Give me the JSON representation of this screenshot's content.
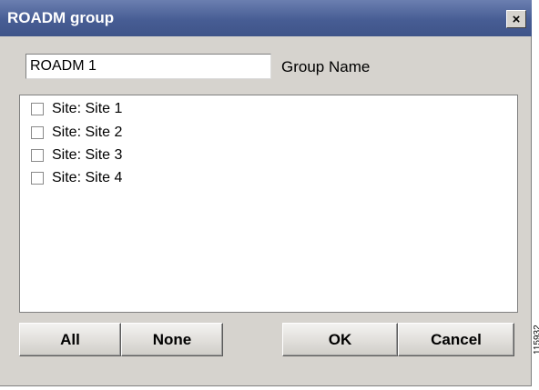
{
  "window": {
    "title": "ROADM group",
    "close_symbol": "×"
  },
  "group_name": {
    "value": "ROADM 1",
    "label": "Group Name"
  },
  "sites": [
    {
      "label": "Site: Site 1",
      "checked": false
    },
    {
      "label": "Site: Site 2",
      "checked": false
    },
    {
      "label": "Site: Site 3",
      "checked": false
    },
    {
      "label": "Site: Site 4",
      "checked": false
    }
  ],
  "buttons": {
    "all": "All",
    "none": "None",
    "ok": "OK",
    "cancel": "Cancel"
  },
  "side_code": "115932",
  "colors": {
    "titlebar": "#475d94",
    "dialog_bg": "#d6d3ce"
  }
}
